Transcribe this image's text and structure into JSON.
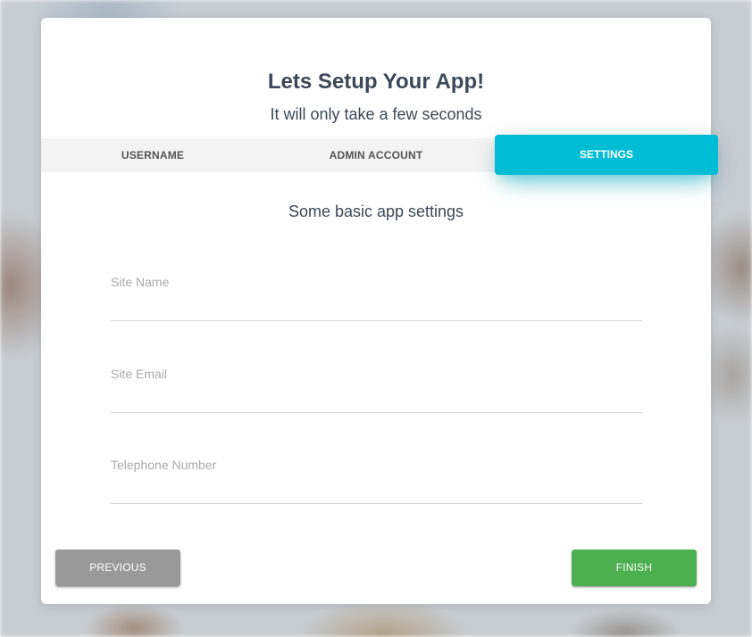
{
  "header": {
    "title": "Lets Setup Your App!",
    "subtitle": "It will only take a few seconds"
  },
  "tabs": [
    {
      "label": "USERNAME",
      "active": false
    },
    {
      "label": "ADMIN ACCOUNT",
      "active": false
    },
    {
      "label": "SETTINGS",
      "active": true
    }
  ],
  "settings": {
    "heading": "Some basic app settings",
    "fields": [
      {
        "label": "Site Name",
        "value": ""
      },
      {
        "label": "Site Email",
        "value": ""
      },
      {
        "label": "Telephone Number",
        "value": ""
      }
    ]
  },
  "buttons": {
    "previous": "PREVIOUS",
    "finish": "FINISH"
  },
  "colors": {
    "accent": "#00bcd4",
    "finish": "#4caf50",
    "previous": "#999999",
    "title_text": "#3c4858"
  }
}
